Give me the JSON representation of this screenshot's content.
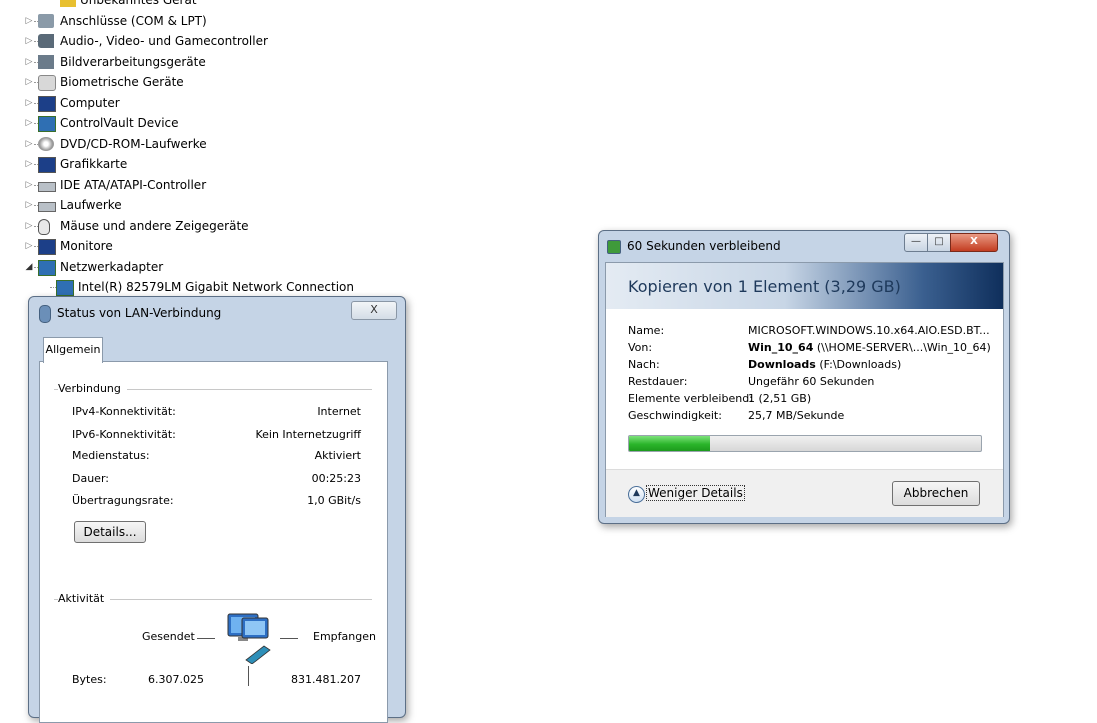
{
  "tree": {
    "items": [
      {
        "label": "Unbekanntes Gerät",
        "icon": "warning-device-icon"
      },
      {
        "label": "Anschlüsse (COM & LPT)",
        "icon": "port-icon"
      },
      {
        "label": "Audio-, Video- und Gamecontroller",
        "icon": "speaker-icon"
      },
      {
        "label": "Bildverarbeitungsgeräte",
        "icon": "camera-icon"
      },
      {
        "label": "Biometrische Geräte",
        "icon": "fingerprint-icon"
      },
      {
        "label": "Computer",
        "icon": "computer-icon"
      },
      {
        "label": "ControlVault Device",
        "icon": "network-device-icon"
      },
      {
        "label": "DVD/CD-ROM-Laufwerke",
        "icon": "disc-drive-icon"
      },
      {
        "label": "Grafikkarte",
        "icon": "display-adapter-icon"
      },
      {
        "label": "IDE ATA/ATAPI-Controller",
        "icon": "ide-controller-icon"
      },
      {
        "label": "Laufwerke",
        "icon": "disk-drive-icon"
      },
      {
        "label": "Mäuse und andere Zeigegeräte",
        "icon": "mouse-icon"
      },
      {
        "label": "Monitore",
        "icon": "monitor-icon"
      },
      {
        "label": "Netzwerkadapter",
        "icon": "network-adapter-icon"
      },
      {
        "label": "Intel(R) 82579LM Gigabit Network Connection",
        "icon": "network-adapter-icon"
      }
    ]
  },
  "lan_status": {
    "title": "Status von LAN-Verbindung",
    "close_label": "X",
    "tab_general": "Allgemein",
    "connection_group": "Verbindung",
    "rows": [
      {
        "label": "IPv4-Konnektivität:",
        "value": "Internet"
      },
      {
        "label": "IPv6-Konnektivität:",
        "value": "Kein Internetzugriff"
      },
      {
        "label": "Medienstatus:",
        "value": "Aktiviert"
      },
      {
        "label": "Dauer:",
        "value": "00:25:23"
      },
      {
        "label": "Übertragungsrate:",
        "value": "1,0 GBit/s"
      }
    ],
    "details_button": "Details...",
    "activity_group": "Aktivität",
    "sent_label": "Gesendet",
    "received_label": "Empfangen",
    "bytes_label": "Bytes:",
    "bytes_sent": "6.307.025",
    "bytes_received": "831.481.207"
  },
  "copy_dialog": {
    "title": "60 Sekunden verbleibend",
    "heading": "Kopieren von 1 Element (3,29 GB)",
    "name_label": "Name:",
    "name_value": "MICROSOFT.WINDOWS.10.x64.AIO.ESD.BT...",
    "from_label": "Von:",
    "from_bold": "Win_10_64",
    "from_path": " (\\\\HOME-SERVER\\...\\Win_10_64)",
    "to_label": "Nach:",
    "to_bold": "Downloads",
    "to_path": " (F:\\Downloads)",
    "remaining_label": "Restdauer:",
    "remaining_value": "Ungefähr 60 Sekunden",
    "items_label": "Elemente verbleibend:",
    "items_value": "1 (2,51 GB)",
    "speed_label": "Geschwindigkeit:",
    "speed_value": "25,7 MB/Sekunde",
    "progress": 0.23,
    "less_details": "Weniger Details",
    "cancel_button": "Abbrechen",
    "close_label": "X"
  }
}
